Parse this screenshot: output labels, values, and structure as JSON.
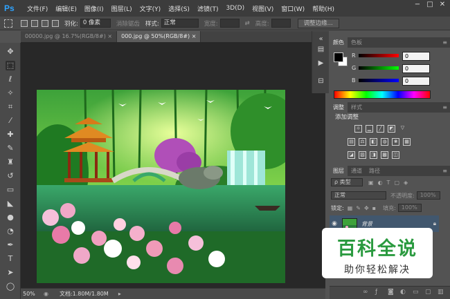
{
  "app": {
    "logo": "Ps"
  },
  "menu": [
    "文件(F)",
    "编辑(E)",
    "图像(I)",
    "图层(L)",
    "文字(Y)",
    "选择(S)",
    "滤镜(T)",
    "3D(D)",
    "视图(V)",
    "窗口(W)",
    "帮助(H)"
  ],
  "window_controls": [
    "−",
    "□",
    "✕"
  ],
  "options": {
    "feather_label": "羽化:",
    "feather_value": "0 像素",
    "antialias_label": "消除锯齿",
    "style_label": "样式:",
    "style_value": "正常",
    "width_label": "宽度:",
    "height_label": "高度:",
    "refine_edge_button": "调整边缘..."
  },
  "tabs": [
    "00000.jpg @ 16.7%(RGB/8#)",
    "000.jpg @ 50%(RGB/8#)"
  ],
  "tab_close": "×",
  "status": {
    "zoom": "50%",
    "doc": "文档:1.80M/1.80M"
  },
  "color_panel": {
    "tabs": [
      "颜色",
      "色板"
    ],
    "channels": [
      {
        "label": "R",
        "value": "0",
        "color": "#cc2020"
      },
      {
        "label": "G",
        "value": "0",
        "color": "#20b020"
      },
      {
        "label": "B",
        "value": "0",
        "color": "#2030d0"
      }
    ]
  },
  "adjustments_panel": {
    "tabs": [
      "调整",
      "样式"
    ],
    "title": "添加调整"
  },
  "layers_panel": {
    "tabs": [
      "图层",
      "通道",
      "路径"
    ],
    "filter_label": "ρ 类型",
    "blend_mode": "正常",
    "opacity_label": "不透明度:",
    "opacity_value": "100%",
    "lock_label": "锁定:",
    "fill_label": "填充:",
    "fill_value": "100%",
    "layer_name": "背景"
  },
  "watermark": {
    "main": "百科全说",
    "sub": "助你轻松解决"
  }
}
